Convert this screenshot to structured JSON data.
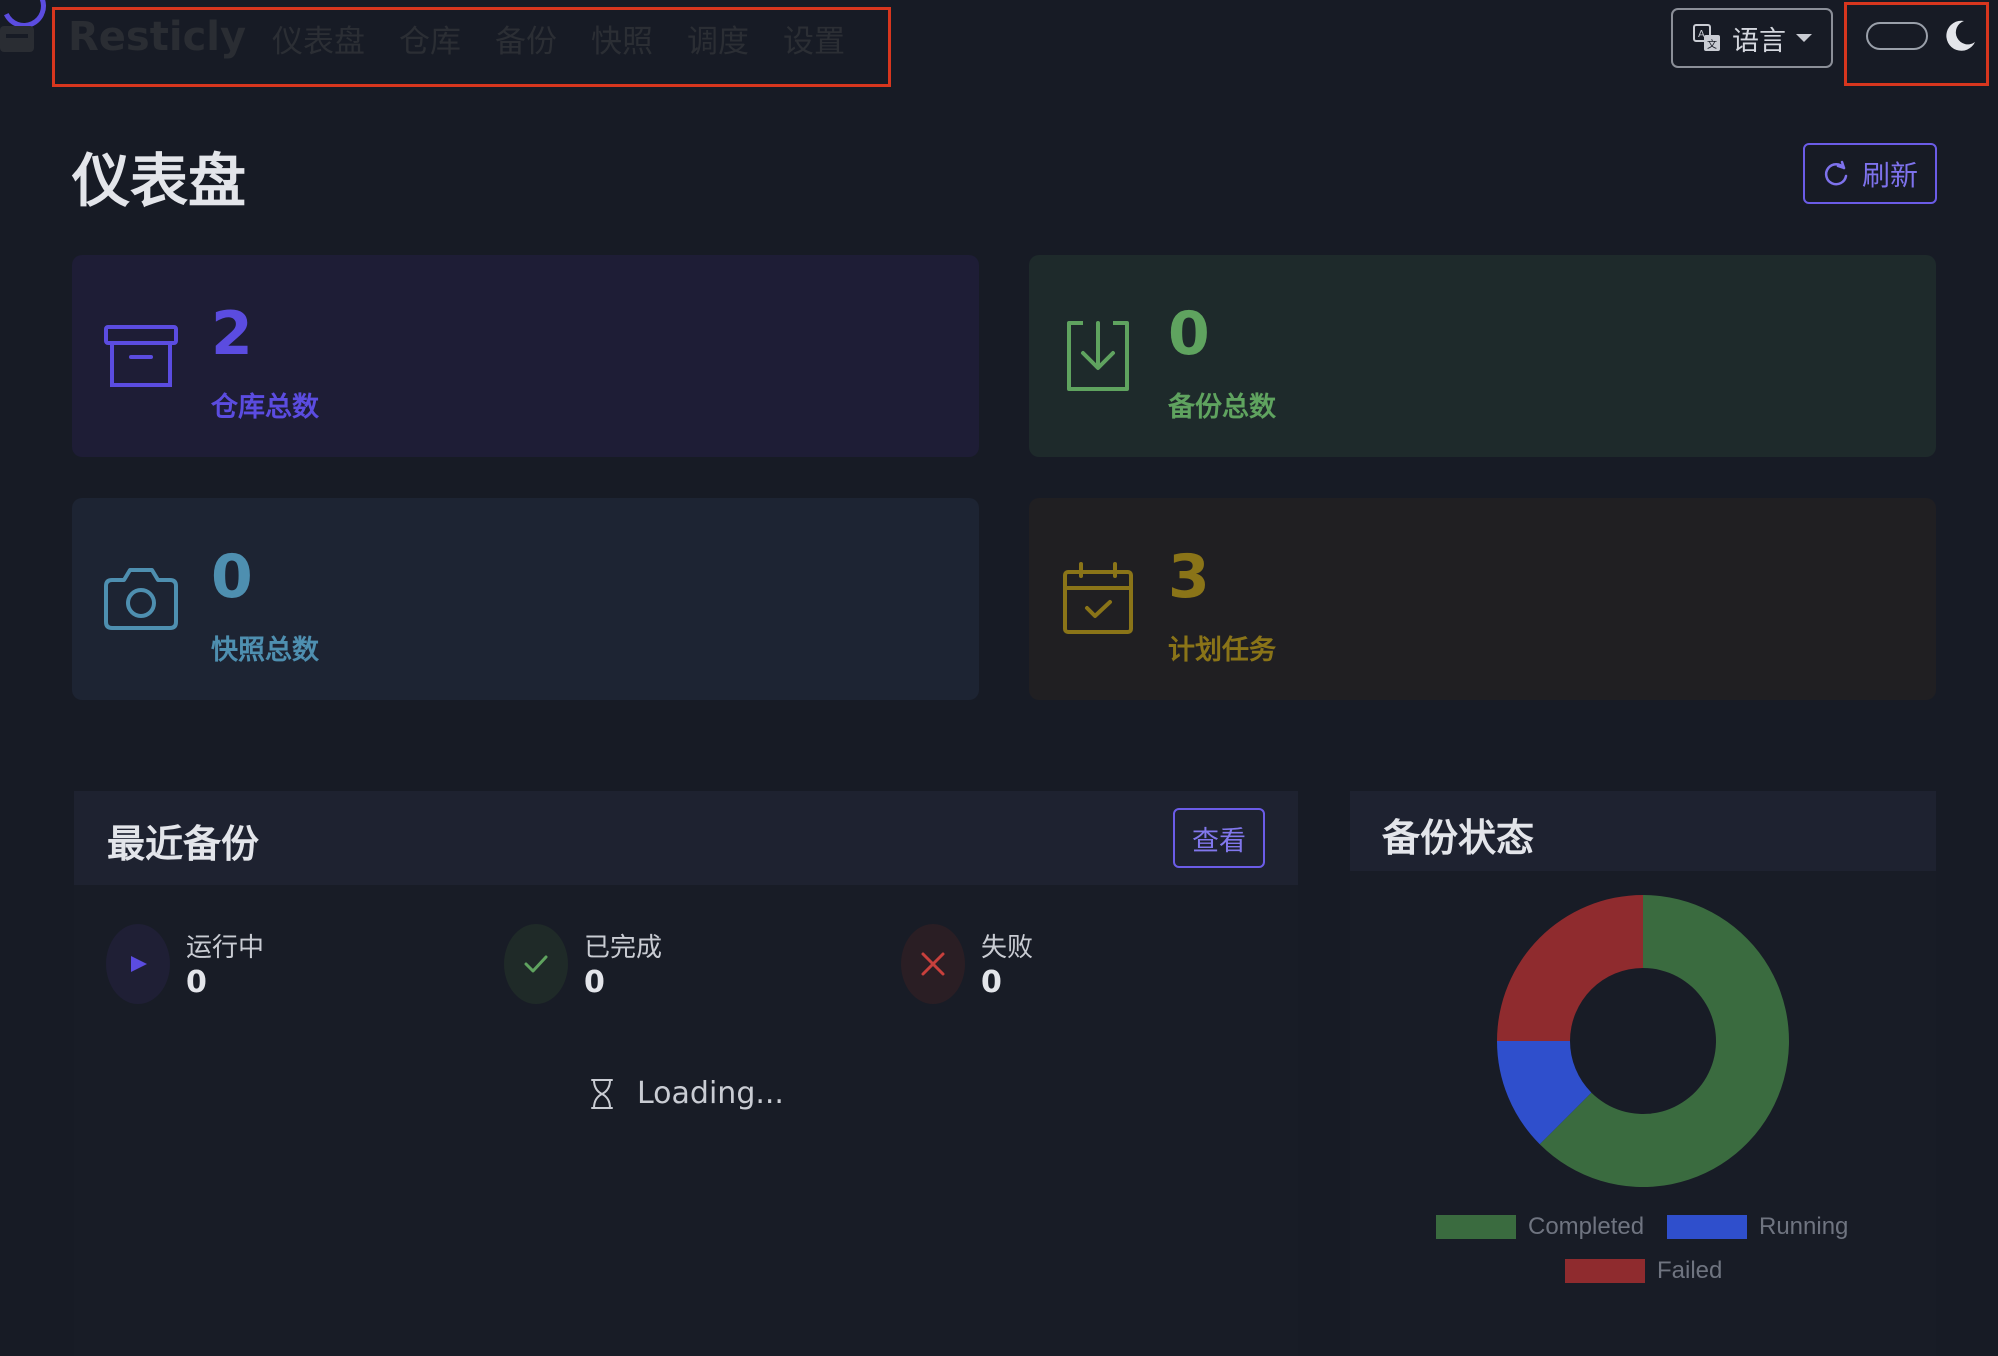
{
  "app": {
    "brand": "Resticly",
    "nav": [
      "仪表盘",
      "仓库",
      "备份",
      "快照",
      "调度",
      "设置"
    ],
    "language_label": "语言"
  },
  "header": {
    "title": "仪表盘",
    "refresh_label": "刷新"
  },
  "stats": [
    {
      "value": "2",
      "label": "仓库总数",
      "icon": "archive-icon",
      "color": "#5b4ce0"
    },
    {
      "value": "0",
      "label": "备份总数",
      "icon": "download-box-icon",
      "color": "#5fa35f"
    },
    {
      "value": "0",
      "label": "快照总数",
      "icon": "camera-icon",
      "color": "#4e8fb0"
    },
    {
      "value": "3",
      "label": "计划任务",
      "icon": "calendar-check-icon",
      "color": "#8a7418"
    }
  ],
  "recent_backups": {
    "title": "最近备份",
    "view_label": "查看",
    "statuses": [
      {
        "name": "运行中",
        "count": "0",
        "icon": "play-icon"
      },
      {
        "name": "已完成",
        "count": "0",
        "icon": "check-icon"
      },
      {
        "name": "失败",
        "count": "0",
        "icon": "x-icon"
      }
    ],
    "loading_text": "Loading..."
  },
  "backup_status": {
    "title": "备份状态"
  },
  "chart_data": {
    "type": "pie",
    "donut": true,
    "categories": [
      "Completed",
      "Running",
      "Failed"
    ],
    "values": [
      62.5,
      12.5,
      25
    ],
    "colors": [
      "#3a6b3f",
      "#2f4fcc",
      "#8f2b2e"
    ],
    "legend_position": "bottom"
  }
}
